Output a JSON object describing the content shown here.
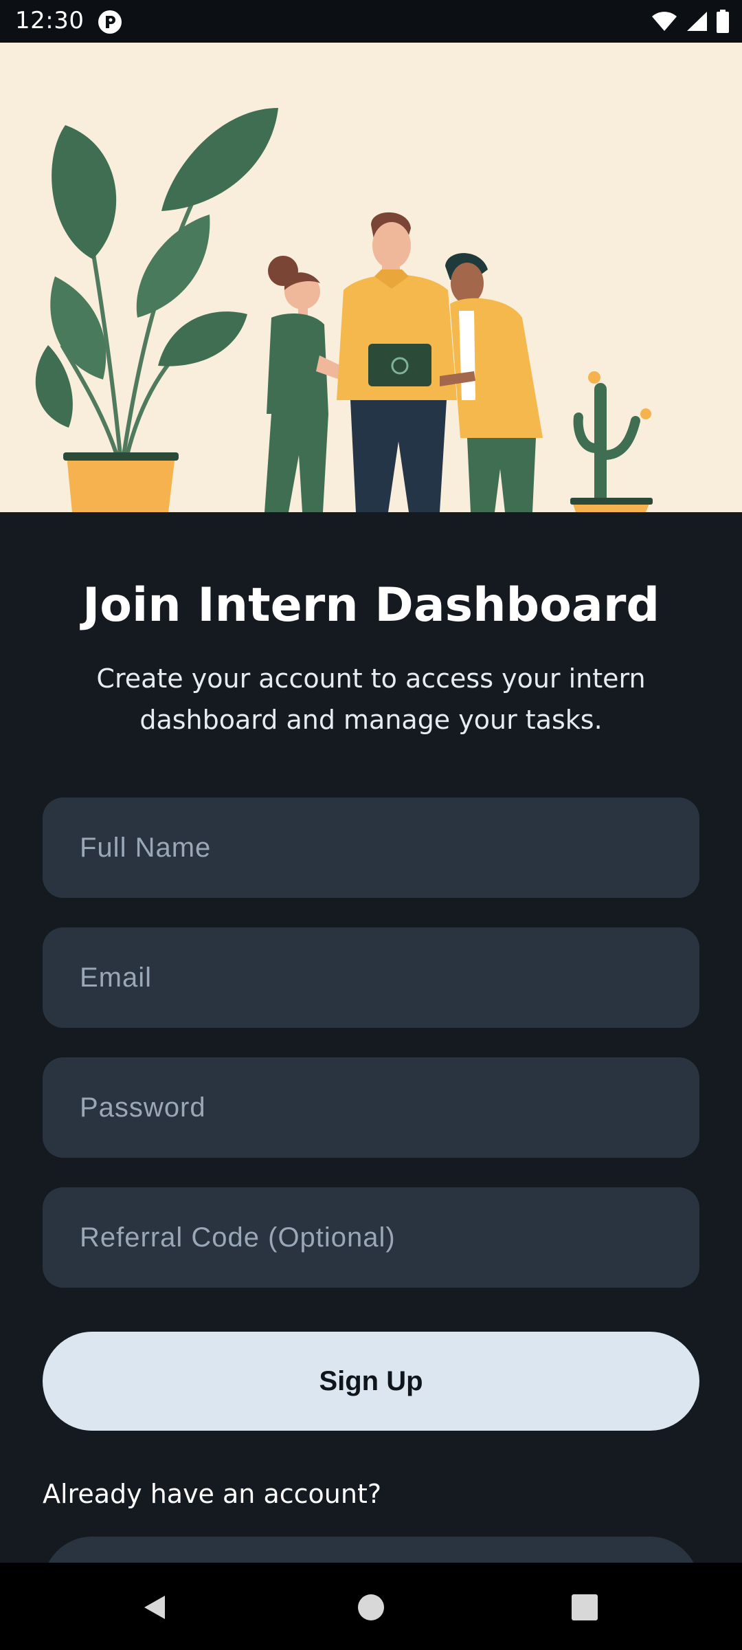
{
  "status_bar": {
    "time": "12:30"
  },
  "signup": {
    "title": "Join Intern Dashboard",
    "subtitle": "Create your account to access your intern dashboard and manage your tasks.",
    "fields": [
      {
        "placeholder": "Full Name",
        "value": ""
      },
      {
        "placeholder": "Email",
        "value": ""
      },
      {
        "placeholder": "Password",
        "value": ""
      },
      {
        "placeholder": "Referral Code (Optional)",
        "value": ""
      }
    ],
    "signup_label": "Sign Up",
    "already_text": "Already have an account?"
  },
  "colors": {
    "background": "#151a21",
    "field_bg": "#2a3440",
    "button_bg": "#dbe6f0",
    "hero_bg": "#f9eedb"
  },
  "icons": [
    "app-notification-icon",
    "wifi-icon",
    "signal-icon",
    "battery-icon",
    "back-icon",
    "home-icon",
    "recents-icon"
  ]
}
